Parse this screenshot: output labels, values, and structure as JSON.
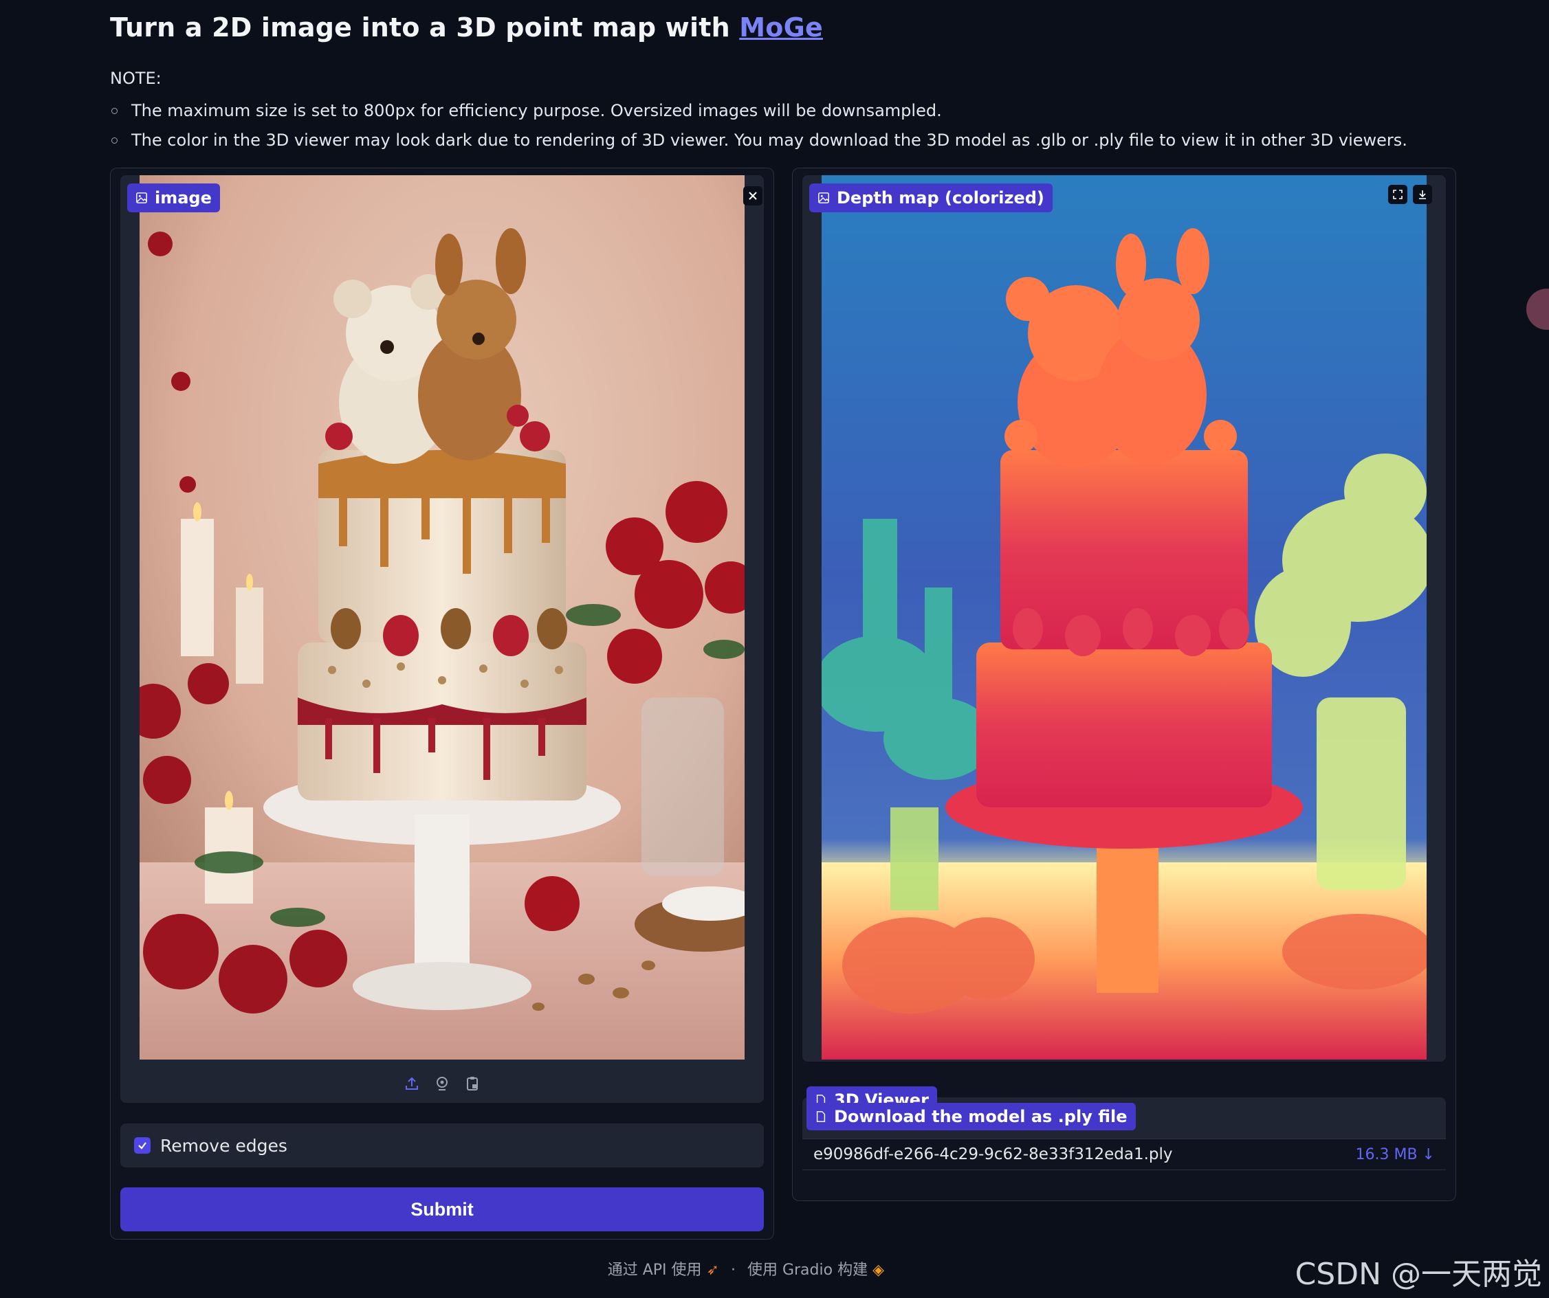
{
  "header": {
    "title_prefix": "Turn a 2D image into a 3D point map with ",
    "title_link": "MoGe"
  },
  "notes": {
    "label": "NOTE:",
    "items": [
      "The maximum size is set to 800px for efficiency purpose. Oversized images will be downsampled.",
      "The color in the 3D viewer may look dark due to rendering of 3D viewer. You may download the 3D model as .glb or .ply file to view it in other 3D viewers."
    ]
  },
  "left_panel": {
    "image_label": "image",
    "remove_edges_label": "Remove edges",
    "remove_edges_checked": true,
    "submit_label": "Submit",
    "toolbar_icons": [
      "upload-icon",
      "webcam-icon",
      "clipboard-icon"
    ]
  },
  "right_panel": {
    "depth_label": "Depth map (colorized)",
    "viewer_label": "3D Viewer",
    "download_label": "Download the model as .ply file",
    "file_name": "e90986df-e266-4c29-9c62-8e33f312eda1.ply",
    "file_size": "16.3 MB ↓"
  },
  "footer": {
    "api_text": "通过 API 使用",
    "separator": "·",
    "built_text": "使用 Gradio 构建"
  },
  "watermark": "CSDN @一天两觉",
  "colors": {
    "background": "#0b0f19",
    "accent": "#4338ca",
    "link": "#7c83f7"
  }
}
